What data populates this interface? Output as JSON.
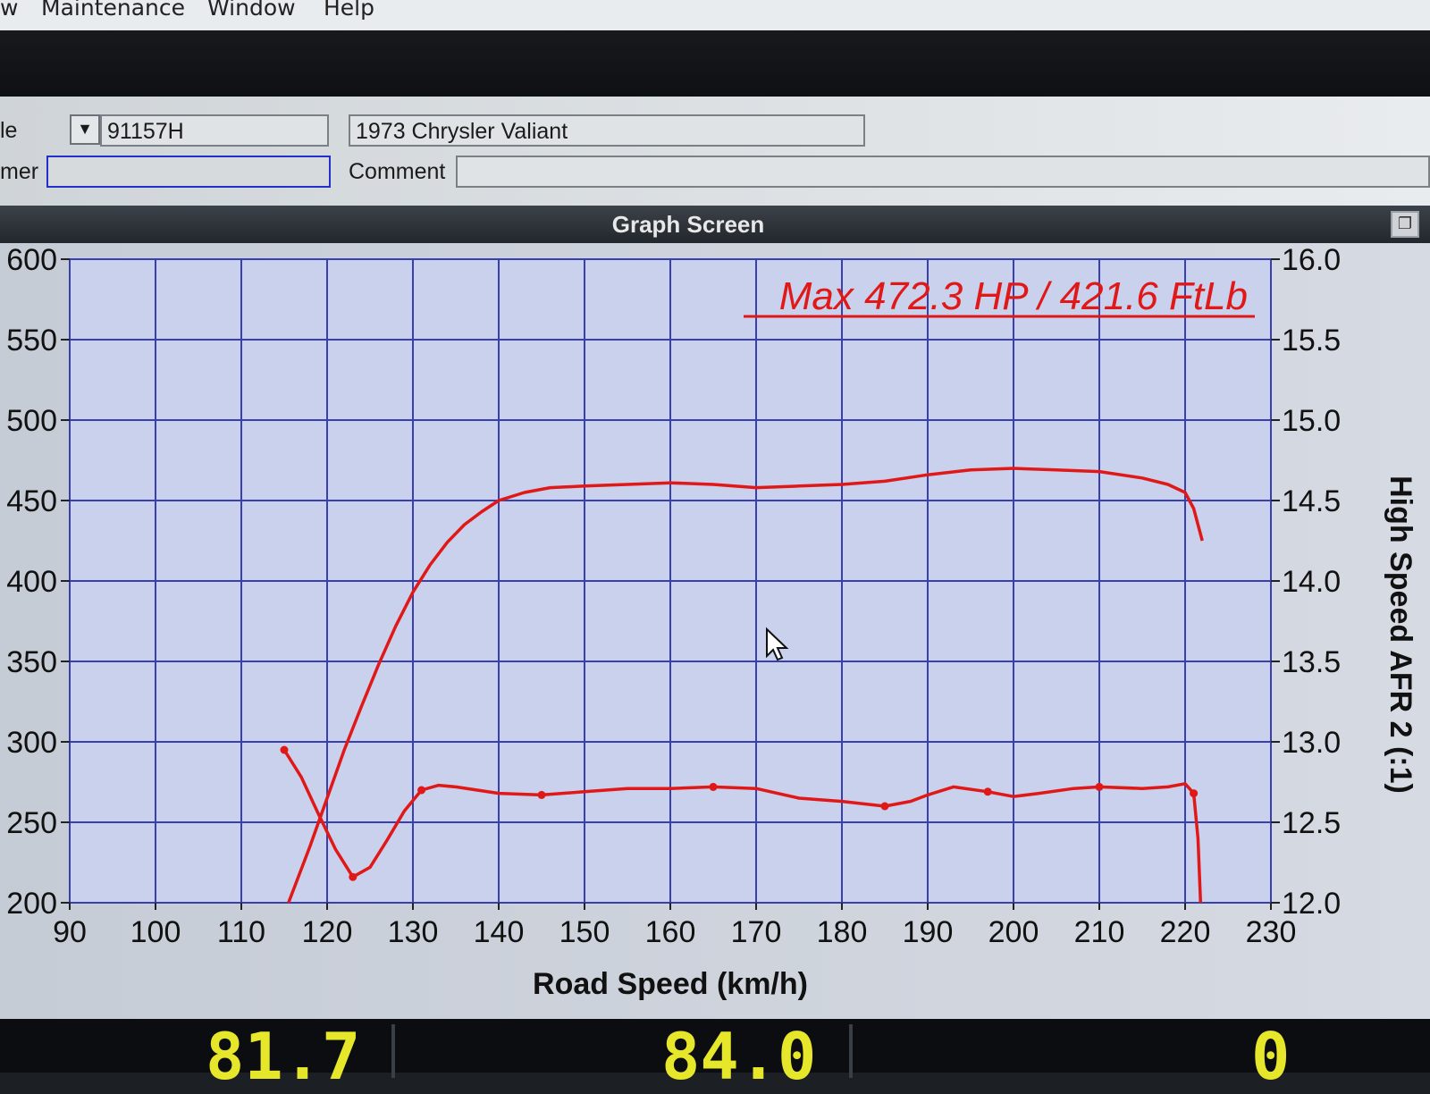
{
  "menu": {
    "items": [
      "w",
      "Maintenance",
      "Window",
      "Help"
    ]
  },
  "form": {
    "file_label": "le",
    "file_value": "91157H",
    "vehicle_value": "1973 Chrysler Valiant",
    "customer_label": "mer",
    "customer_value": "",
    "comment_label": "Comment",
    "comment_value": ""
  },
  "graph_window": {
    "title": "Graph Screen"
  },
  "icons": [
    "dropdown-arrow-icon",
    "restore-window-icon",
    "mouse-cursor-icon"
  ],
  "colors": {
    "curve": "#e01818",
    "grid": "#3a3fb0",
    "plot_bg": "#c9d1ec"
  },
  "readout": {
    "values": [
      "81.7",
      "84.0",
      "0"
    ]
  },
  "chart_data": {
    "type": "line",
    "title": "Max 472.3 HP  / 421.6 FtLb",
    "xlabel": "Road Speed (km/h)",
    "ylabel": "",
    "y2label": "High Speed AFR 2 (:1)",
    "xlim": [
      90,
      230
    ],
    "ylim": [
      200,
      600
    ],
    "y2lim": [
      12.0,
      16.0
    ],
    "x_ticks": [
      "90",
      "100",
      "110",
      "120",
      "130",
      "140",
      "150",
      "160",
      "170",
      "180",
      "190",
      "200",
      "210",
      "220",
      "230"
    ],
    "y_ticks": [
      "200",
      "250",
      "300",
      "350",
      "400",
      "450",
      "500",
      "550",
      "600"
    ],
    "y2_ticks": [
      "12.0",
      "12.5",
      "13.0",
      "13.5",
      "14.0",
      "14.5",
      "15.0",
      "15.5",
      "16.0"
    ],
    "grid": true,
    "series": [
      {
        "axis": "left",
        "markers": false,
        "x": [
          115.5,
          118,
          120,
          122,
          124,
          126,
          128,
          130,
          132,
          134,
          136,
          138,
          140,
          143,
          146,
          150,
          155,
          160,
          165,
          170,
          175,
          180,
          185,
          190,
          195,
          200,
          205,
          210,
          215,
          218,
          220,
          221,
          222
        ],
        "y": [
          200,
          235,
          265,
          295,
          322,
          348,
          372,
          393,
          410,
          424,
          435,
          443,
          450,
          455,
          458,
          459,
          460,
          461,
          460,
          458,
          459,
          460,
          462,
          466,
          469,
          470,
          469,
          468,
          464,
          460,
          455,
          445,
          425
        ]
      },
      {
        "axis": "right",
        "markers": true,
        "x": [
          115,
          117,
          119,
          121,
          123,
          125,
          127,
          129,
          131,
          133,
          135,
          140,
          145,
          150,
          155,
          160,
          165,
          170,
          175,
          180,
          185,
          188,
          190,
          193,
          197,
          200,
          203,
          207,
          210,
          215,
          218,
          220,
          221,
          221.5,
          221.8
        ],
        "y": [
          12.95,
          12.78,
          12.55,
          12.33,
          12.16,
          12.22,
          12.39,
          12.57,
          12.7,
          12.73,
          12.72,
          12.68,
          12.67,
          12.69,
          12.71,
          12.71,
          12.72,
          12.71,
          12.65,
          12.63,
          12.6,
          12.63,
          12.67,
          12.72,
          12.69,
          12.66,
          12.68,
          12.71,
          12.72,
          12.71,
          12.72,
          12.74,
          12.68,
          12.4,
          12.0
        ]
      }
    ]
  }
}
